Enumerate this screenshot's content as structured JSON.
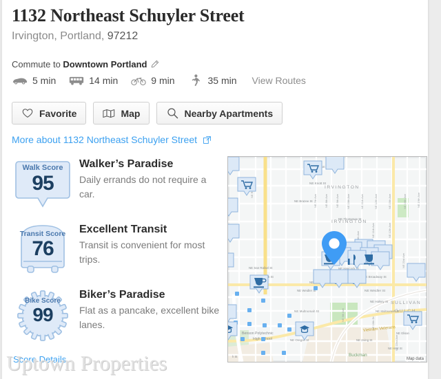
{
  "header": {
    "title": "1132 Northeast Schuyler Street",
    "locality": "Irvington, Portland",
    "zip": "97212"
  },
  "commute": {
    "prefix": "Commute to ",
    "destination": "Downtown Portland",
    "edit_icon": "pencil-icon",
    "modes": [
      {
        "icon": "car-icon",
        "time": "5 min"
      },
      {
        "icon": "bus-icon",
        "time": "14 min"
      },
      {
        "icon": "bike-icon",
        "time": "9 min"
      },
      {
        "icon": "walk-icon",
        "time": "35 min"
      }
    ],
    "view_routes": "View Routes"
  },
  "actions": [
    {
      "label": "Favorite",
      "icon": "heart-icon"
    },
    {
      "label": "Map",
      "icon": "map-icon"
    },
    {
      "label": "Nearby Apartments",
      "icon": "search-icon"
    }
  ],
  "more_link": {
    "label": "More about 1132 Northeast Schuyler Street",
    "icon": "external-link-icon"
  },
  "scores": [
    {
      "badge_label": "Walk Score",
      "value": "95",
      "heading": "Walker’s Paradise",
      "description": "Daily errands do not require a car."
    },
    {
      "badge_label": "Transit Score",
      "value": "76",
      "heading": "Excellent Transit",
      "description": "Transit is convenient for most trips."
    },
    {
      "badge_label": "Bike Score",
      "value": "99",
      "heading": "Biker’s Paradise",
      "description": "Flat as a pancake, excellent bike lanes."
    }
  ],
  "score_details_link": "Score Details",
  "watermark": "Uptown Properties",
  "map": {
    "attribution": "Map data",
    "neighborhood_labels": [
      "IRVINGTON",
      "IRVINGTON",
      "SULLIVAN",
      "GULCH",
      "Buckman"
    ],
    "place_labels": [
      "Benson Polytechnic High School",
      "Vietnam Veterans"
    ],
    "street_labels": [
      "NE Stanton St",
      "NE Knott St",
      "NE Brazee St",
      "NE Thompson St",
      "NE Tillamook St",
      "NE Hancock St",
      "NE San Rafael St",
      "NE Schuyler St",
      "NE Broadway St",
      "NE Weidler St",
      "NE Halsey St",
      "NE Multnomah St",
      "NE Oregon St",
      "NE Irving St",
      "NE Hoyt St",
      "NE Glisan St"
    ],
    "avenue_labels": [
      "NE 7th Ave",
      "NE 8th Ave",
      "NE 9th Ave",
      "NE 10th Ave",
      "NE 11th Ave",
      "NE 12th Ave",
      "NE 15th Ave",
      "NE 16th Ave",
      "NE 19th Ave",
      "NE 21st Ave",
      "NE 22nd Ave",
      "NE 24th Ave",
      "NE Rodney Ave",
      "NE Martin Luther King Jr Blvd"
    ],
    "marker": "location-pin",
    "poi_icons": [
      "shopping-cart",
      "coffee-cup",
      "restaurant-fork-knife",
      "shopping-bag",
      "graduation-cap",
      "bank"
    ]
  },
  "colors": {
    "link": "#3ba0f0",
    "badge_fill": "#dfeaf8",
    "badge_border": "#9fc0e3",
    "badge_label": "#4a78ad",
    "badge_value": "#1c3f61",
    "marker": "#3f9cf5",
    "text": "#2b2b2b",
    "muted": "#8a8a8a"
  }
}
